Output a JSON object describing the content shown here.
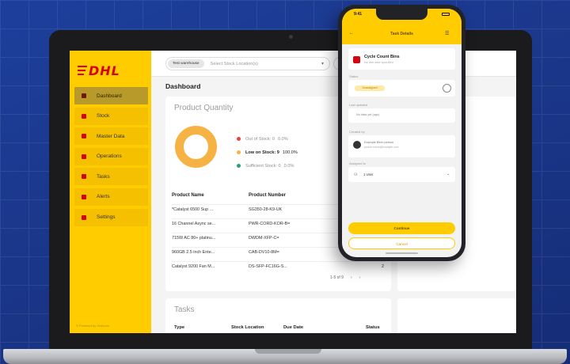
{
  "brand": {
    "logo_text": "DHL",
    "primary_color": "#ffcc00",
    "accent_color": "#d40511"
  },
  "sidebar": {
    "items": [
      {
        "label": "Dashboard",
        "active": true
      },
      {
        "label": "Stock"
      },
      {
        "label": "Master Data"
      },
      {
        "label": "Operations"
      },
      {
        "label": "Tasks"
      },
      {
        "label": "Alerts"
      },
      {
        "label": "Settings"
      }
    ],
    "footer": "© Powered by Ventures"
  },
  "topbar": {
    "warehouse_chip": "Test warehouse",
    "location_placeholder": "Select Stock Location(s)"
  },
  "dashboard": {
    "title": "Dashboard",
    "product_quantity": {
      "title": "Product Quantity",
      "legend": [
        {
          "label": "Out of Stock: 0",
          "pct": "0.0%",
          "color": "#e8423b"
        },
        {
          "label": "Low on Stock: 9",
          "pct": "100.0%",
          "color": "#f6b344",
          "bold": true
        },
        {
          "label": "Sufficient Stock: 0",
          "pct": "0.0%",
          "color": "#2e9e77"
        }
      ],
      "columns": [
        "Product Name",
        "Product Number"
      ],
      "rows": [
        {
          "name": "*Catalyst 6500 Sup ...",
          "number": "SG350-28-K9-UK",
          "qty": ""
        },
        {
          "name": "16 Channel Async se...",
          "number": "PWR-CORD-KOR-B=",
          "qty": ""
        },
        {
          "name": "715W AC 80+ platinu...",
          "number": "DWDM-XFP-C=",
          "qty": ""
        },
        {
          "name": "960GB 2.5 inch Ente...",
          "number": "CAB-DV10-8M=",
          "qty": ""
        },
        {
          "name": "Catalyst 9200 Fan M...",
          "number": "DS-SFP-FC16G-S...",
          "qty": "2"
        }
      ],
      "pagination": {
        "range": "1-5 of 9",
        "prev": "‹",
        "next": "›"
      }
    },
    "tasks": {
      "title": "Tasks",
      "columns": [
        "Type",
        "Stock Location",
        "Due Date",
        "Status"
      ]
    }
  },
  "phone": {
    "status_time": "9:41",
    "header_title": "Task Details",
    "task": {
      "name": "Cycle Count Bins",
      "subtitle": "No due date specified"
    },
    "status": {
      "label": "Status",
      "value": "Unassigned"
    },
    "last_updated": {
      "label": "Last updated",
      "value": "No data yet (ago)"
    },
    "created_by": {
      "label": "Created by",
      "name": "Example Bech person",
      "email": "person.name@example.com"
    },
    "assigned_to": {
      "label": "Assigned to",
      "value": "1 User"
    },
    "buttons": {
      "primary": "Continue",
      "secondary": "Cancel"
    }
  }
}
